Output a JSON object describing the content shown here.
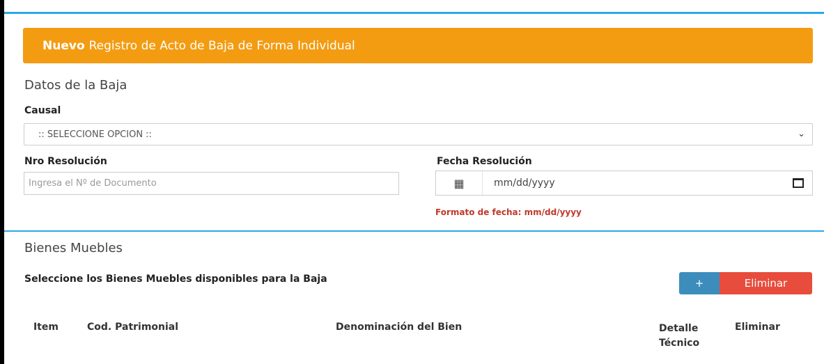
{
  "banner": {
    "bold": "Nuevo",
    "text": "Registro de Acto de Baja de Forma Individual"
  },
  "datos": {
    "title": "Datos de la Baja",
    "causal_label": "Causal",
    "causal_value": ":: SELECCIONE OPCION ::",
    "nro_label": "Nro Resolución",
    "nro_placeholder": "Ingresa el Nº de Documento",
    "fecha_label": "Fecha Resolución",
    "fecha_value": "mm/dd/yyyy",
    "fecha_hint": "Formato de fecha:  mm/dd/yyyy"
  },
  "bienes": {
    "title": "Bienes Muebles",
    "subtitle": "Seleccione los Bienes Muebles disponibles para la Baja",
    "add_label": "+",
    "delete_label": "Eliminar",
    "columns": [
      "Item",
      "Cod. Patrimonial",
      "Denominación del Bien",
      "Detalle Técnico",
      "Eliminar"
    ]
  },
  "icons": {
    "calendar": "calendar-icon",
    "chevron": "chevron-down-icon"
  },
  "colors": {
    "banner": "#f39c12",
    "accent": "#29a9e6",
    "add": "#3c8dbc",
    "delete": "#e74c3c",
    "hint": "#c0392b"
  }
}
